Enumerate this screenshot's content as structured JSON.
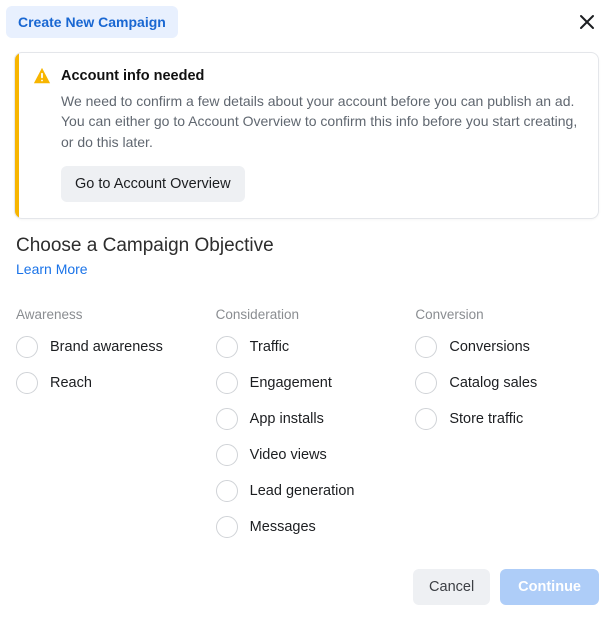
{
  "header": {
    "pill_label": "Create New Campaign"
  },
  "alert": {
    "title": "Account info needed",
    "description": "We need to confirm a few details about your account before you can publish an ad. You can either go to Account Overview to confirm this info before you start creating, or do this later.",
    "action_label": "Go to Account Overview"
  },
  "objective": {
    "title": "Choose a Campaign Objective",
    "learn_more": "Learn More"
  },
  "columns": {
    "awareness": {
      "header": "Awareness",
      "items": [
        "Brand awareness",
        "Reach"
      ]
    },
    "consideration": {
      "header": "Consideration",
      "items": [
        "Traffic",
        "Engagement",
        "App installs",
        "Video views",
        "Lead generation",
        "Messages"
      ]
    },
    "conversion": {
      "header": "Conversion",
      "items": [
        "Conversions",
        "Catalog sales",
        "Store traffic"
      ]
    }
  },
  "footer": {
    "cancel": "Cancel",
    "continue": "Continue"
  }
}
